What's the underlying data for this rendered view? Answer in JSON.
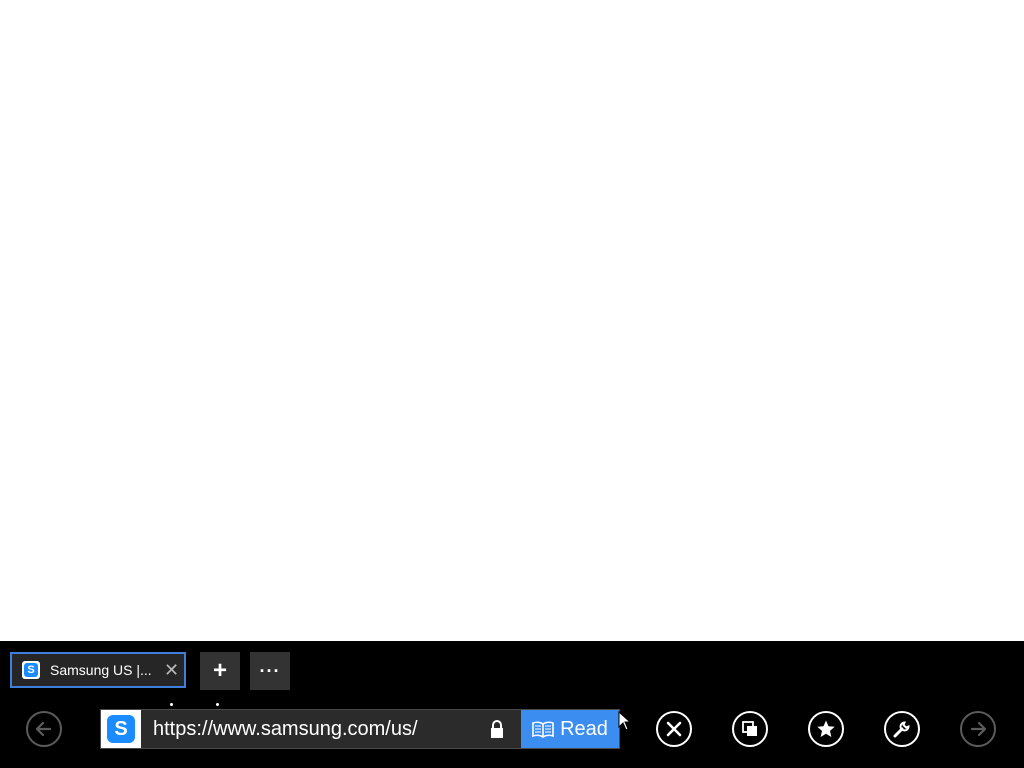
{
  "tab": {
    "title": "Samsung US |...",
    "favicon_letter": "S",
    "close_glyph": "✕"
  },
  "tab_controls": {
    "new_tab": "+",
    "more": "···"
  },
  "address_bar": {
    "url": "https://www.samsung.com/us/",
    "site_icon_letter": "S",
    "read_label": "Read"
  },
  "icons": {
    "back": "back-arrow-icon",
    "stop": "close-icon",
    "tabs": "tabs-icon",
    "favorites": "star-icon",
    "tools": "wrench-icon",
    "forward": "forward-arrow-icon",
    "lock": "lock-icon",
    "reading_view": "book-icon"
  },
  "colors": {
    "app_bar": "#000000",
    "accent": "#3b8df0",
    "tab_border": "#3f7fdc",
    "favicon_blue": "#1a8cff"
  }
}
